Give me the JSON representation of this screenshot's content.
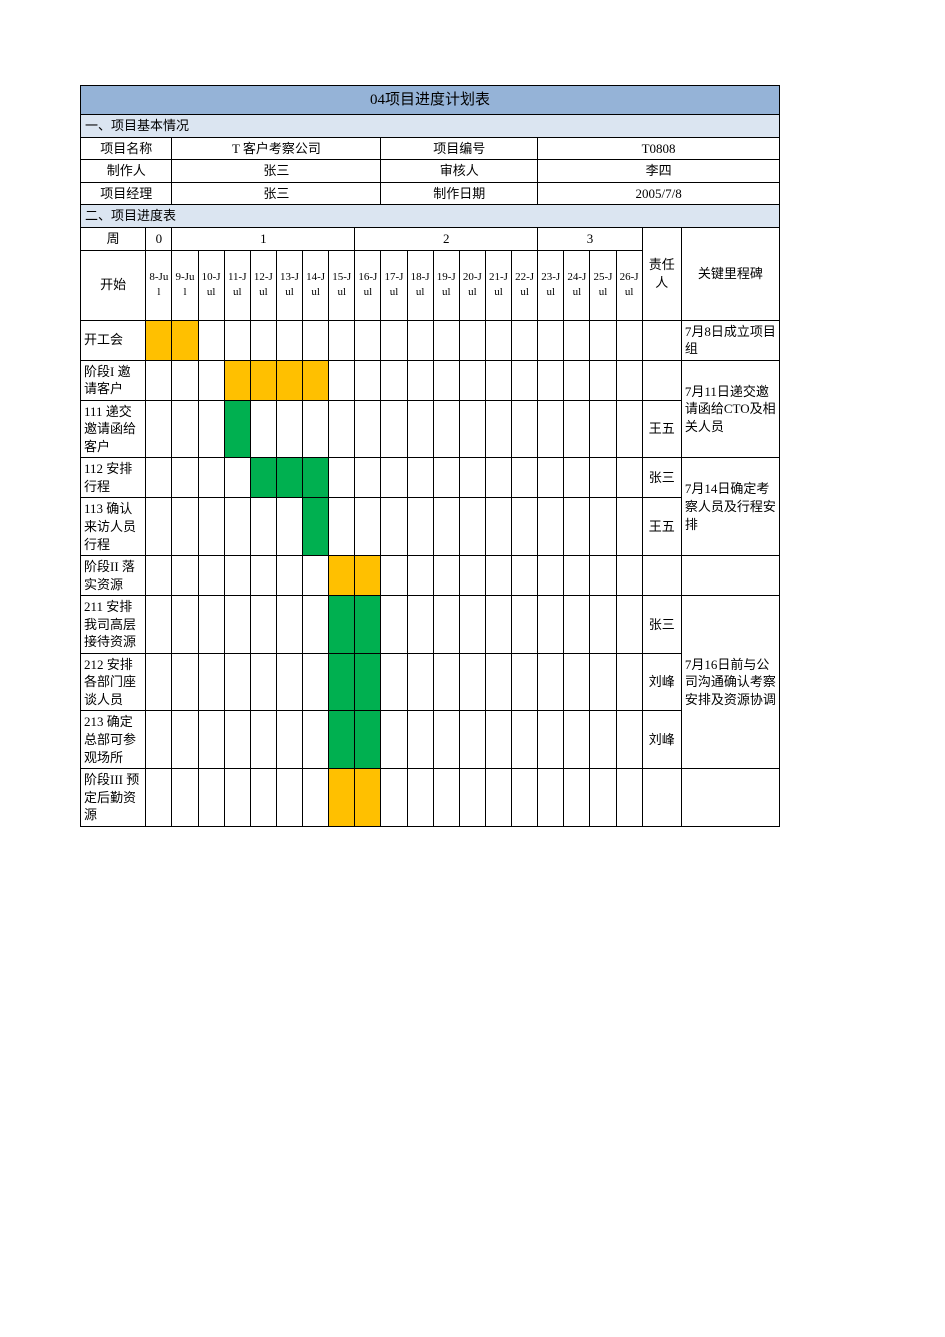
{
  "title": "04项目进度计划表",
  "section1": "一、项目基本情况",
  "info": {
    "r1c1_label": "项目名称",
    "r1c1_val": "T 客户考察公司",
    "r1c2_label": "项目编号",
    "r1c2_val": "T0808",
    "r2c1_label": "制作人",
    "r2c1_val": "张三",
    "r2c2_label": "审核人",
    "r2c2_val": "李四",
    "r3c1_label": "项目经理",
    "r3c1_val": "张三",
    "r3c2_label": "制作日期",
    "r3c2_val": "2005/7/8"
  },
  "section2": "二、项目进度表",
  "header": {
    "week_label": "周",
    "weeks": [
      "0",
      "1",
      "2",
      "3"
    ],
    "start_label": "开始",
    "owner_label": "责任人",
    "milestone_label": "关键里程碑",
    "days": [
      "8-Jul",
      "9-Jul",
      "10-Jul",
      "11-Jul",
      "12-Jul",
      "13-Jul",
      "14-Jul",
      "15-Jul",
      "16-Jul",
      "17-Jul",
      "18-Jul",
      "19-Jul",
      "20-Jul",
      "21-Jul",
      "22-Jul",
      "23-Jul",
      "24-Jul",
      "25-Jul",
      "26-Jul"
    ]
  },
  "rows": [
    {
      "task": "开工会",
      "owner": "",
      "bars": [
        {
          "from": 0,
          "to": 1,
          "cls": "yellow"
        }
      ],
      "milestone": "7月8日成立项目组",
      "mspan": 1
    },
    {
      "task": "阶段I  邀请客户",
      "owner": "",
      "bars": [
        {
          "from": 3,
          "to": 6,
          "cls": "yellow"
        }
      ],
      "milestone": "7月11日递交邀请函给CTO及相关人员",
      "mspan": 2
    },
    {
      "task": "111  递交邀请函给客户",
      "owner": "王五",
      "bars": [
        {
          "from": 3,
          "to": 3,
          "cls": "green"
        }
      ]
    },
    {
      "task": "112  安排行程",
      "owner": "张三",
      "bars": [
        {
          "from": 4,
          "to": 6,
          "cls": "green"
        }
      ],
      "milestone": "7月14日确定考察人员及行程安排",
      "mspan": 2
    },
    {
      "task": "113  确认来访人员行程",
      "owner": "王五",
      "bars": [
        {
          "from": 6,
          "to": 6,
          "cls": "green"
        }
      ]
    },
    {
      "task": "阶段II  落实资源",
      "owner": "",
      "bars": [
        {
          "from": 7,
          "to": 8,
          "cls": "yellow"
        }
      ],
      "milestone": "",
      "mspan": 1
    },
    {
      "task": "211  安排我司高层接待资源",
      "owner": "张三",
      "bars": [
        {
          "from": 7,
          "to": 8,
          "cls": "green"
        }
      ],
      "milestone": "7月16日前与公司沟通确认考察安排及资源协调",
      "mspan": 3
    },
    {
      "task": "212  安排各部门座谈人员",
      "owner": "刘峰",
      "bars": [
        {
          "from": 7,
          "to": 8,
          "cls": "green"
        }
      ]
    },
    {
      "task": "213  确定总部可参观场所",
      "owner": "刘峰",
      "bars": [
        {
          "from": 7,
          "to": 8,
          "cls": "green"
        }
      ]
    },
    {
      "task": "阶段III 预定后勤资源",
      "owner": "",
      "bars": [
        {
          "from": 7,
          "to": 8,
          "cls": "yellow"
        }
      ],
      "milestone": "",
      "mspan": 1
    }
  ],
  "chart_data": {
    "type": "gantt",
    "x_labels": [
      "8-Jul",
      "9-Jul",
      "10-Jul",
      "11-Jul",
      "12-Jul",
      "13-Jul",
      "14-Jul",
      "15-Jul",
      "16-Jul",
      "17-Jul",
      "18-Jul",
      "19-Jul",
      "20-Jul",
      "21-Jul",
      "22-Jul",
      "23-Jul",
      "24-Jul",
      "25-Jul",
      "26-Jul"
    ],
    "series": [
      {
        "name": "开工会",
        "start": "8-Jul",
        "end": "9-Jul",
        "category": "phase"
      },
      {
        "name": "阶段I 邀请客户",
        "start": "11-Jul",
        "end": "14-Jul",
        "category": "phase"
      },
      {
        "name": "111 递交邀请函给客户",
        "start": "11-Jul",
        "end": "11-Jul",
        "category": "task",
        "owner": "王五"
      },
      {
        "name": "112 安排行程",
        "start": "12-Jul",
        "end": "14-Jul",
        "category": "task",
        "owner": "张三"
      },
      {
        "name": "113 确认来访人员行程",
        "start": "14-Jul",
        "end": "14-Jul",
        "category": "task",
        "owner": "王五"
      },
      {
        "name": "阶段II 落实资源",
        "start": "15-Jul",
        "end": "16-Jul",
        "category": "phase"
      },
      {
        "name": "211 安排我司高层接待资源",
        "start": "15-Jul",
        "end": "16-Jul",
        "category": "task",
        "owner": "张三"
      },
      {
        "name": "212 安排各部门座谈人员",
        "start": "15-Jul",
        "end": "16-Jul",
        "category": "task",
        "owner": "刘峰"
      },
      {
        "name": "213 确定总部可参观场所",
        "start": "15-Jul",
        "end": "16-Jul",
        "category": "task",
        "owner": "刘峰"
      },
      {
        "name": "阶段III 预定后勤资源",
        "start": "15-Jul",
        "end": "16-Jul",
        "category": "phase"
      }
    ],
    "legend": {
      "phase": "#ffc000",
      "task": "#00b050"
    }
  }
}
